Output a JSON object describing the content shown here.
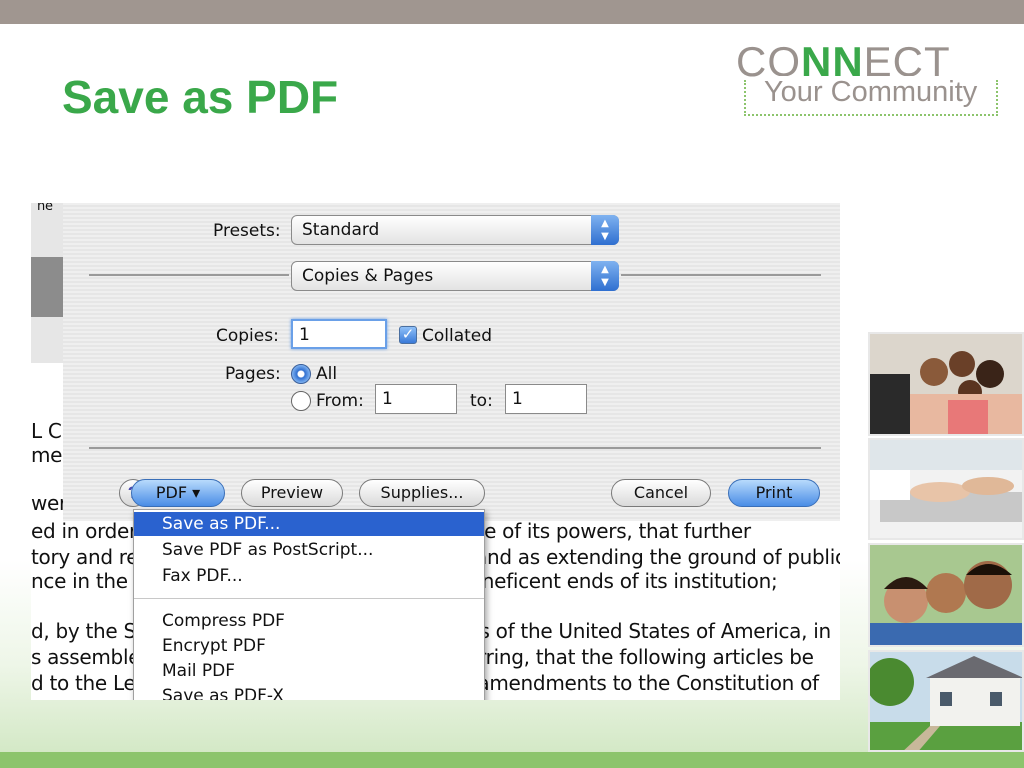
{
  "slide": {
    "title": "Save as PDF",
    "logo_connect_pre": "CO",
    "logo_connect_nn": "NN",
    "logo_connect_post": "ECT",
    "logo_tagline": "Your Community"
  },
  "document_lines": [
    "ne",
    "L C",
    "mer",
    "wer",
    "ed in order to prevent misconstruction or abuse of its powers, that further",
    "tory and restrictive clauses should be added, and as extending the ground of public",
    "nce in the Government, will best insure the beneficent ends of its institution;",
    "d, by the Senate and House of Representatives of the United States of America, in",
    "s assembled, two thirds of both Houses concurring, that the following articles be",
    "d to the Legislatures of the several States, as amendments to the Constitution of"
  ],
  "print_dialog": {
    "presets_label": "Presets:",
    "presets_value": "Standard",
    "section_value": "Copies & Pages",
    "copies_label": "Copies:",
    "copies_value": "1",
    "collated_label": "Collated",
    "pages_label": "Pages:",
    "all_label": "All",
    "from_label": "From:",
    "from_value": "1",
    "to_label": "to:",
    "to_value": "1",
    "help_label": "?",
    "pdf_button": "PDF ▾",
    "preview_button": "Preview",
    "supplies_button": "Supplies...",
    "cancel_button": "Cancel",
    "print_button": "Print"
  },
  "pdf_menu": {
    "items": [
      "Save as PDF...",
      "Save PDF as PostScript...",
      "Fax PDF...",
      "Compress PDF",
      "Encrypt PDF",
      "Mail PDF",
      "Save as PDF-X"
    ],
    "selected": "Save as PDF..."
  }
}
